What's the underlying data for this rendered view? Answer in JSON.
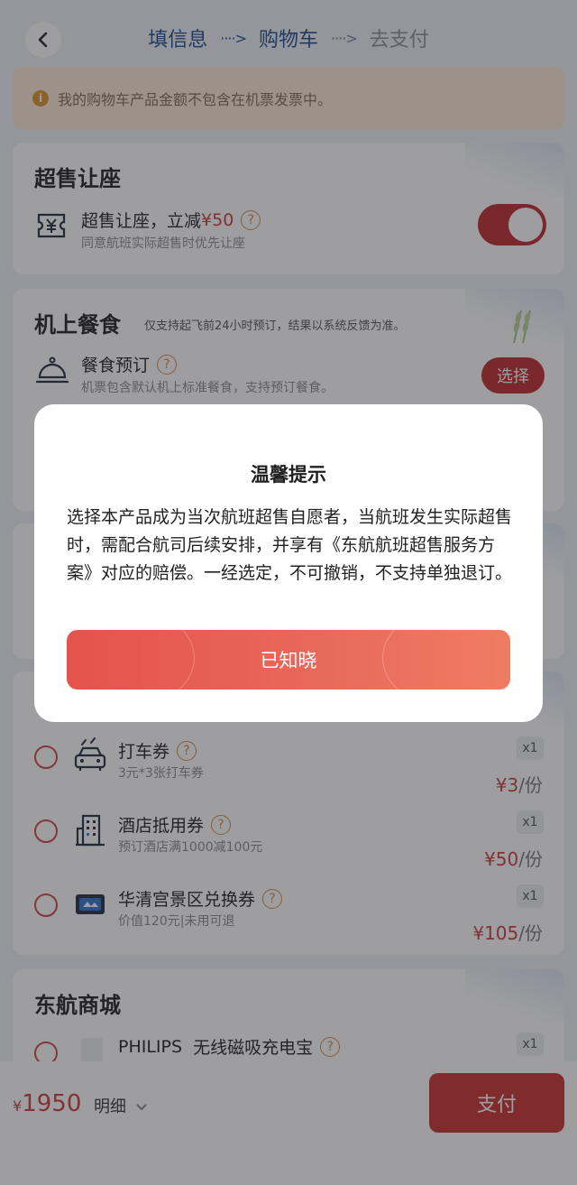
{
  "header": {
    "steps": [
      "填信息",
      "购物车",
      "去支付"
    ],
    "arrow": "····>"
  },
  "notice": {
    "icon": "i",
    "text": "我的购物车产品金额不包含在机票发票中。"
  },
  "oversale": {
    "title": "超售让座",
    "item_title": "超售让座，立减",
    "item_price": "¥50",
    "item_desc": "同意航班实际超售时优先让座",
    "toggle_on": true
  },
  "meal": {
    "title": "机上餐食",
    "note": "仅支持起飞前24小时预订，结果以系统反馈为准。",
    "item_title": "餐食预订",
    "item_desc": "机票包含默认机上标准餐食，支持预订餐食。",
    "select_label": "选择"
  },
  "vouchers": [
    {
      "title": "打车券",
      "desc": "3元*3张打车券",
      "qty": "x1",
      "price": "¥3",
      "per": "/份",
      "icon": "taxi-icon"
    },
    {
      "title": "酒店抵用券",
      "desc": "预订酒店满1000减100元",
      "qty": "x1",
      "price": "¥50",
      "per": "/份",
      "icon": "hotel-icon"
    },
    {
      "title": "华清宫景区兑换券",
      "desc": "价值120元|未用可退",
      "qty": "x1",
      "price": "¥105",
      "per": "/份",
      "icon": "ticket-icon"
    }
  ],
  "mall": {
    "title": "东航商城",
    "item_brand": "PHILIPS",
    "item_title": "无线磁吸充电宝",
    "qty": "x1"
  },
  "question_mark": "?",
  "bottom": {
    "currency": "¥",
    "total": "1950",
    "detail_label": "明细",
    "pay_label": "支付"
  },
  "modal": {
    "title": "温馨提示",
    "body": "选择本产品成为当次航班超售自愿者，当航班发生实际超售时，需配合航司后续安排，并享有《东航航班超售服务方案》对应的赔偿。一经选定，不可撤销，不支持单独退订。",
    "button": "已知晓"
  },
  "colors": {
    "brand_red": "#c0282f",
    "step_blue": "#1b4a8f",
    "notice_bg": "#fbead6"
  }
}
